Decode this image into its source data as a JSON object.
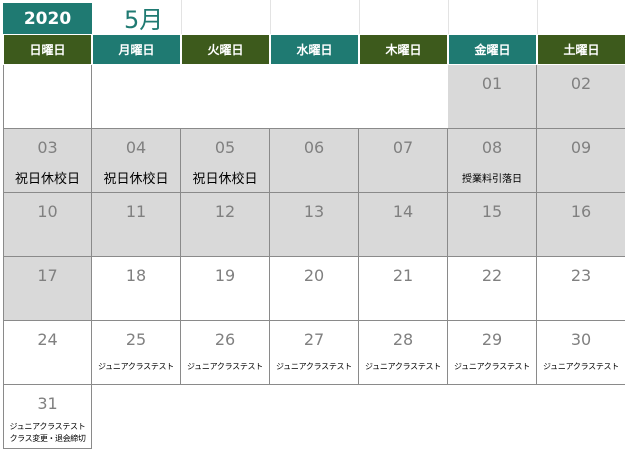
{
  "header": {
    "year": "2020",
    "month": "5月"
  },
  "weekdays": [
    {
      "label": "日曜日",
      "color": "#3d5a1c"
    },
    {
      "label": "月曜日",
      "color": "#1f7a72"
    },
    {
      "label": "火曜日",
      "color": "#3d5a1c"
    },
    {
      "label": "水曜日",
      "color": "#1f7a72"
    },
    {
      "label": "木曜日",
      "color": "#3d5a1c"
    },
    {
      "label": "金曜日",
      "color": "#1f7a72"
    },
    {
      "label": "土曜日",
      "color": "#3d5a1c"
    }
  ],
  "colors": {
    "teal": "#1f7a72",
    "green": "#3d5a1c",
    "shaded_day": "#d9d9d9",
    "day_number": "#808080"
  },
  "days": [
    {
      "num": "01",
      "shaded": true,
      "notes": []
    },
    {
      "num": "02",
      "shaded": true,
      "notes": []
    },
    {
      "num": "03",
      "shaded": true,
      "notes": [
        "祝日休校日"
      ]
    },
    {
      "num": "04",
      "shaded": true,
      "notes": [
        "祝日休校日"
      ]
    },
    {
      "num": "05",
      "shaded": true,
      "notes": [
        "祝日休校日"
      ]
    },
    {
      "num": "06",
      "shaded": true,
      "notes": []
    },
    {
      "num": "07",
      "shaded": true,
      "notes": []
    },
    {
      "num": "08",
      "shaded": true,
      "notes": [
        "授業料引落日"
      ]
    },
    {
      "num": "09",
      "shaded": true,
      "notes": []
    },
    {
      "num": "10",
      "shaded": true,
      "notes": []
    },
    {
      "num": "11",
      "shaded": true,
      "notes": []
    },
    {
      "num": "12",
      "shaded": true,
      "notes": []
    },
    {
      "num": "13",
      "shaded": true,
      "notes": []
    },
    {
      "num": "14",
      "shaded": true,
      "notes": []
    },
    {
      "num": "15",
      "shaded": true,
      "notes": []
    },
    {
      "num": "16",
      "shaded": true,
      "notes": []
    },
    {
      "num": "17",
      "shaded": true,
      "notes": []
    },
    {
      "num": "18",
      "shaded": false,
      "notes": []
    },
    {
      "num": "19",
      "shaded": false,
      "notes": []
    },
    {
      "num": "20",
      "shaded": false,
      "notes": []
    },
    {
      "num": "21",
      "shaded": false,
      "notes": []
    },
    {
      "num": "22",
      "shaded": false,
      "notes": []
    },
    {
      "num": "23",
      "shaded": false,
      "notes": []
    },
    {
      "num": "24",
      "shaded": false,
      "notes": []
    },
    {
      "num": "25",
      "shaded": false,
      "notes": [
        "ジュニアクラステスト"
      ]
    },
    {
      "num": "26",
      "shaded": false,
      "notes": [
        "ジュニアクラステスト"
      ]
    },
    {
      "num": "27",
      "shaded": false,
      "notes": [
        "ジュニアクラステスト"
      ]
    },
    {
      "num": "28",
      "shaded": false,
      "notes": [
        "ジュニアクラステスト"
      ]
    },
    {
      "num": "29",
      "shaded": false,
      "notes": [
        "ジュニアクラステスト"
      ]
    },
    {
      "num": "30",
      "shaded": false,
      "notes": [
        "ジュニアクラステスト"
      ]
    },
    {
      "num": "31",
      "shaded": false,
      "notes": [
        "ジュニアクラステスト",
        "クラス変更・退会締切"
      ]
    }
  ]
}
